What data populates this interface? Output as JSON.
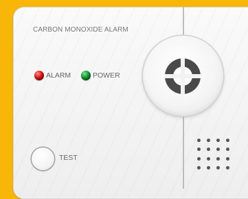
{
  "device": {
    "title": "CARBON MONOXIDE ALARM",
    "indicators": [
      {
        "label": "ALARM",
        "color": "#E01818"
      },
      {
        "label": "POWER",
        "color": "#169B34"
      }
    ],
    "test_button": {
      "label": "TEST"
    },
    "main_button": {
      "icon": "co-sensor-icon"
    },
    "speaker": {
      "icon": "speaker-grille"
    }
  },
  "colors": {
    "background": "#F7B608",
    "panel": "#F5F5F5"
  }
}
